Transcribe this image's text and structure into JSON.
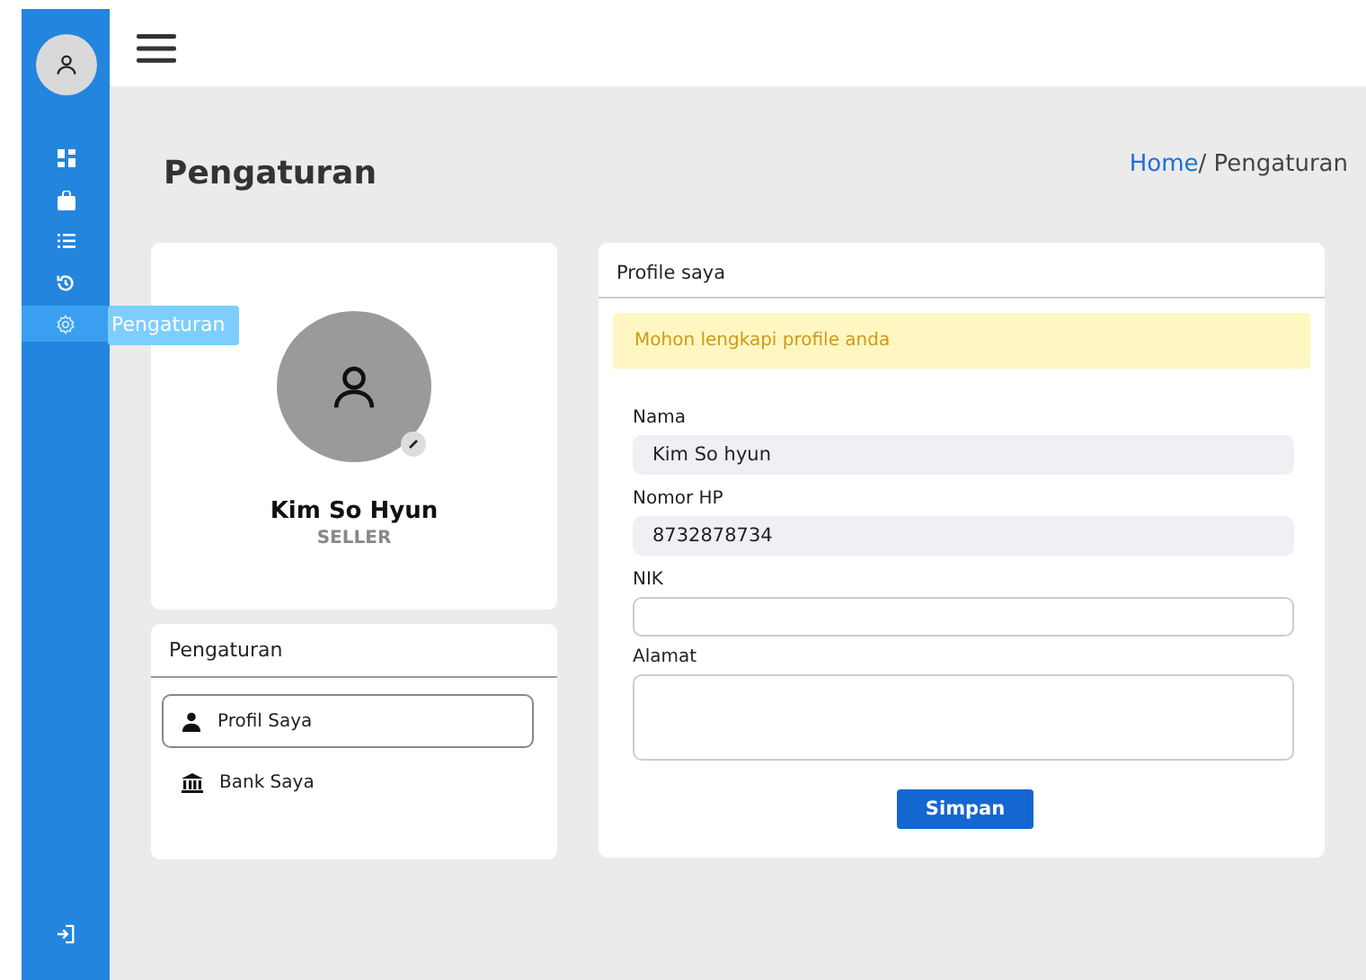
{
  "sidebar": {
    "items": [
      {
        "kind": "dashboard",
        "selected": false
      },
      {
        "kind": "bag",
        "selected": false
      },
      {
        "kind": "list",
        "selected": false
      },
      {
        "kind": "history",
        "selected": false
      },
      {
        "kind": "settings",
        "selected": true,
        "tooltip": "Pengaturan"
      }
    ],
    "bottom_item": {
      "kind": "logout"
    }
  },
  "page_title": "Pengaturan",
  "breadcrumb": {
    "link": "Home",
    "current": "/ Pengaturan"
  },
  "profile_card": {
    "name": "Kim So Hyun",
    "role": "SELLER"
  },
  "settings_menu": {
    "title": "Pengaturan",
    "items": [
      {
        "label": "Profil Saya",
        "kind": "person",
        "selected": true
      },
      {
        "label": "Bank Saya",
        "kind": "bank",
        "selected": false
      }
    ]
  },
  "profile_form": {
    "title": "Profile saya",
    "alert": "Mohon lengkapi profile anda",
    "fields": [
      {
        "label": "Nama",
        "kind": "readonly",
        "value": "Kim So hyun"
      },
      {
        "label": "Nomor HP",
        "kind": "readonly",
        "value": "8732878734"
      },
      {
        "label": "NIK",
        "kind": "input"
      },
      {
        "label": "Alamat",
        "kind": "textarea"
      }
    ],
    "submit": "Simpan"
  }
}
